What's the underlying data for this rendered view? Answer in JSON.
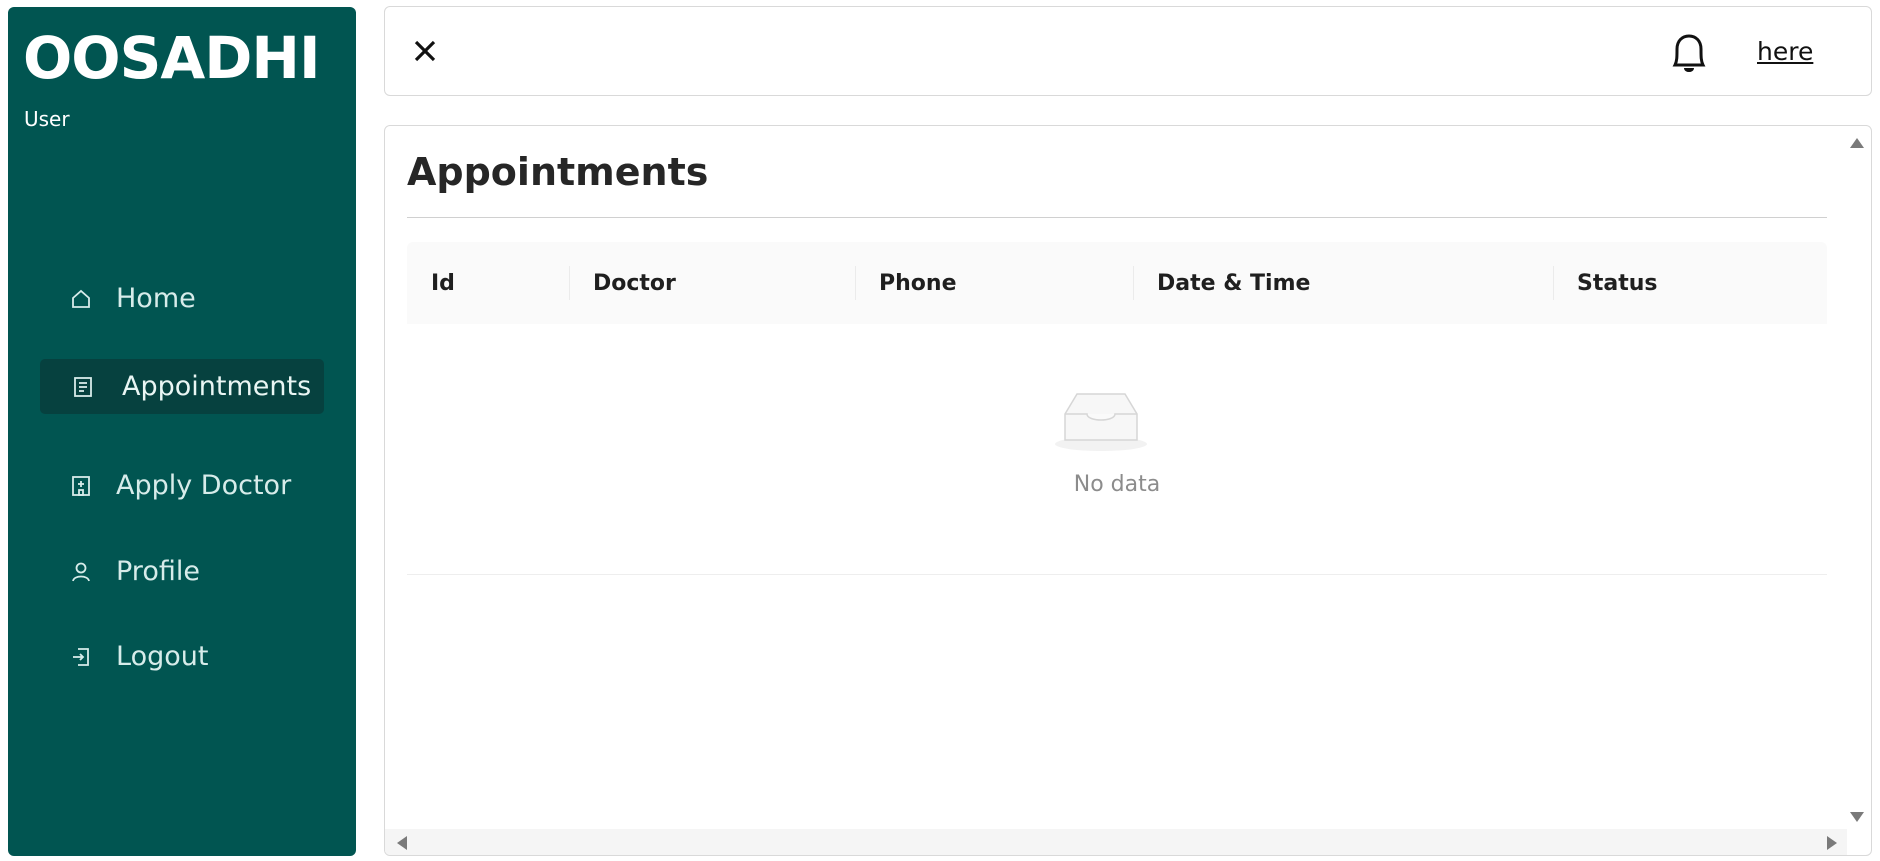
{
  "sidebar": {
    "brand": "OOSADHI",
    "role": "User",
    "bg_color": "#015551",
    "items": [
      {
        "label": "Home",
        "icon": "home-icon",
        "active": false
      },
      {
        "label": "Appointments",
        "icon": "list-icon",
        "active": true
      },
      {
        "label": "Apply Doctor",
        "icon": "hospital-icon",
        "active": false
      },
      {
        "label": "Profile",
        "icon": "user-icon",
        "active": false
      },
      {
        "label": "Logout",
        "icon": "logout-icon",
        "active": false
      }
    ]
  },
  "header": {
    "close_icon": "close-icon",
    "bell_icon": "bell-icon",
    "link_label": "here"
  },
  "main": {
    "title": "Appointments",
    "table": {
      "columns": [
        "Id",
        "Doctor",
        "Phone",
        "Date & Time",
        "Status"
      ],
      "rows": [],
      "empty_text": "No data"
    }
  }
}
